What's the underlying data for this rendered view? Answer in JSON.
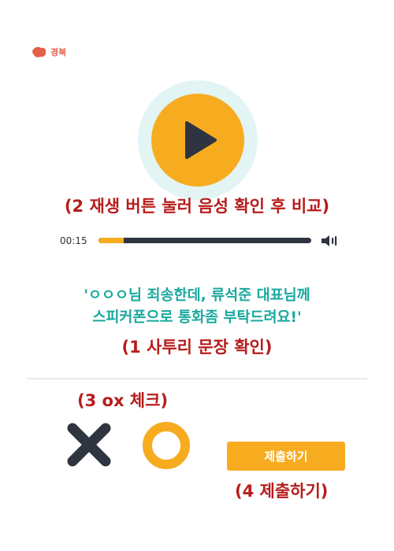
{
  "header": {
    "logo_text": "경북"
  },
  "player": {
    "annotation": "(2 재생 버튼 눌러 음성 확인 후 비교)",
    "current_time": "00:15",
    "progress": 0.12,
    "accent": "#f7ac20",
    "track_color": "#2f3540"
  },
  "sentence": {
    "line1": "'ㅇㅇㅇ님 죄송한데, 류석준 대표님께",
    "line2": "스피커폰으로 통화좀 부탁드려요!'",
    "annotation": "(1 사투리 문장 확인)",
    "color": "#1aa99e"
  },
  "answer": {
    "annotation": "(3 ox 체크)",
    "x_icon": "x-mark-icon",
    "o_icon": "o-circle-icon",
    "submit_label": "제출하기",
    "submit_annotation": "(4 제출하기)"
  },
  "colors": {
    "annotation": "#b71c1c",
    "x": "#2f3540",
    "o": "#f7ac20"
  }
}
